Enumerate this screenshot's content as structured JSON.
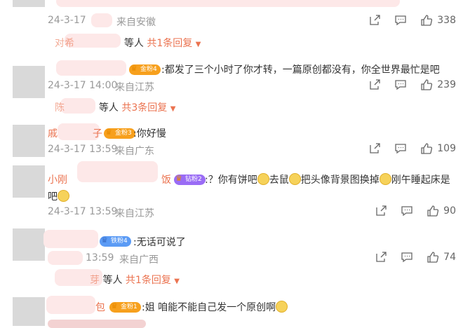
{
  "comments": [
    {
      "meta_time": "24-3-17",
      "meta_loc": "来自安徽",
      "likes": "338",
      "reply_summary": {
        "name": "对希",
        "suffix": "等人",
        "more": "共1条回复"
      }
    },
    {
      "badge": "金粉4",
      "text": ":都发了三个小时了你才转，一篇原创都没有，你全世界最忙是吧",
      "meta_time": "24-3-17 14:00",
      "meta_loc": "来自江苏",
      "likes": "239",
      "reply_summary": {
        "name": "陈",
        "suffix": "等人",
        "more": "共3条回复"
      }
    },
    {
      "name": "戚",
      "name_tail": "子",
      "badge": "金粉3",
      "text": ":你好慢",
      "meta_time": "24-3-17 13:59",
      "meta_loc": "来自广东",
      "likes": "109"
    },
    {
      "name": "小刚",
      "name_tail": "饭",
      "badge": "钻粉2",
      "text_a": ":？你有饼吧",
      "text_b": "去鼠",
      "text_c": "把头像背景图换掉",
      "text_d": "刚午睡起床是",
      "text_e": "吧",
      "meta_time": "24-3-17 13:59",
      "meta_loc": "来自江苏",
      "likes": "90"
    },
    {
      "badge": "铁粉4",
      "text": ":无话可说了",
      "meta_time": "13:59",
      "meta_loc": "来自广西",
      "likes": "74",
      "reply_summary": {
        "name": "芽",
        "suffix": "等人",
        "more": "共1条回复"
      }
    },
    {
      "name": "包",
      "badge": "金粉1",
      "text": ":姐 咱能不能自己发一个原创啊"
    }
  ],
  "icons": {
    "share": "share-icon",
    "comment": "comment-icon",
    "like": "like-icon"
  },
  "colors": {
    "name": "#eb7350",
    "meta": "#999999",
    "gold_badge": "#f7a01d",
    "blue_badge": "#5b9bf5"
  }
}
